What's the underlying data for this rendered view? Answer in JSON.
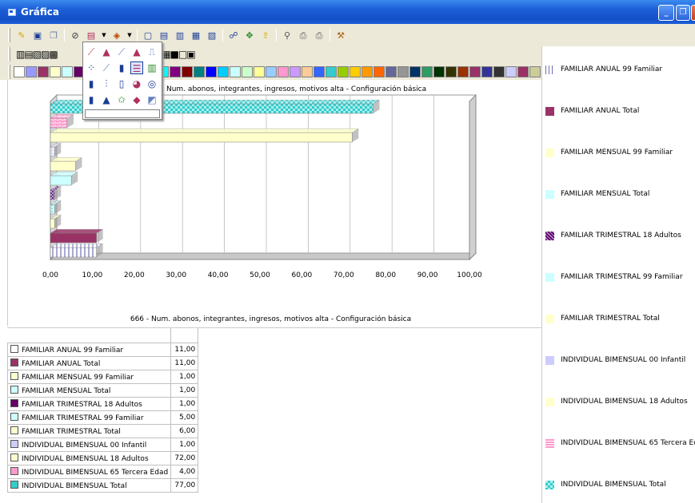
{
  "window": {
    "title": "Gráfica"
  },
  "palette_colors": [
    "#ffffff",
    "#9999ff",
    "#993366",
    "#ffffcc",
    "#ccffff",
    "#660066",
    "#ff8080",
    "#0066cc",
    "#ccccff",
    "#000080",
    "#ff00ff",
    "#ffff00",
    "#00ffff",
    "#800080",
    "#800000",
    "#008080",
    "#0000ff",
    "#00ccff",
    "#ccffff",
    "#ccffcc",
    "#ffff99",
    "#99ccff",
    "#ff99cc",
    "#cc99ff",
    "#ffcc99",
    "#3366ff",
    "#33cccc",
    "#99cc00",
    "#ffcc00",
    "#ff9900",
    "#ff6600",
    "#666699",
    "#969696",
    "#003366",
    "#339966",
    "#003300",
    "#333300",
    "#993300",
    "#993366",
    "#333399",
    "#333333",
    "#ccccff",
    "#993366",
    "#cccc99",
    "#99cccc",
    "#660066",
    "#cc6666",
    "#003366"
  ],
  "chart": {
    "top_title": "Num. abonos, integrantes, ingresos, motivos alta - Configuración básica",
    "bottom_title": "666 - Num. abonos, integrantes, ingresos, motivos alta - Configuración básica"
  },
  "chart_data": {
    "type": "bar",
    "orientation": "horizontal",
    "xlim": [
      0,
      100
    ],
    "x_ticks": [
      "0,00",
      "10,00",
      "20,00",
      "30,00",
      "40,00",
      "50,00",
      "60,00",
      "70,00",
      "80,00",
      "90,00",
      "100,00"
    ],
    "series": [
      {
        "name": "FAMILIAR ANUAL 99 Familiar",
        "value": 11.0,
        "value_label": "11,00",
        "color": "#ffffff",
        "pattern": "vlines"
      },
      {
        "name": "FAMILIAR ANUAL Total",
        "value": 11.0,
        "value_label": "11,00",
        "color": "#993366"
      },
      {
        "name": "FAMILIAR MENSUAL 99 Familiar",
        "value": 1.0,
        "value_label": "1,00",
        "color": "#ffffcc"
      },
      {
        "name": "FAMILIAR MENSUAL Total",
        "value": 1.0,
        "value_label": "1,00",
        "color": "#ccffff",
        "pattern": "dots"
      },
      {
        "name": "FAMILIAR TRIMESTRAL 18 Adultos",
        "value": 1.0,
        "value_label": "1,00",
        "color": "#660066",
        "pattern": "cross"
      },
      {
        "name": "FAMILIAR TRIMESTRAL 99 Familiar",
        "value": 5.0,
        "value_label": "5,00",
        "color": "#ccffff"
      },
      {
        "name": "FAMILIAR TRIMESTRAL Total",
        "value": 6.0,
        "value_label": "6,00",
        "color": "#ffffcc"
      },
      {
        "name": "INDIVIDUAL BIMENSUAL 00 Infantil",
        "value": 1.0,
        "value_label": "1,00",
        "color": "#ccccff",
        "pattern": "grid"
      },
      {
        "name": "INDIVIDUAL BIMENSUAL 18 Adultos",
        "value": 72.0,
        "value_label": "72,00",
        "color": "#ffffcc"
      },
      {
        "name": "INDIVIDUAL BIMENSUAL 65 Tercera Edad",
        "value": 4.0,
        "value_label": "4,00",
        "color": "#ff99cc",
        "pattern": "brick"
      },
      {
        "name": "INDIVIDUAL BIMENSUAL Total",
        "value": 77.0,
        "value_label": "77,00",
        "color": "#33cccc",
        "pattern": "checker"
      }
    ]
  }
}
